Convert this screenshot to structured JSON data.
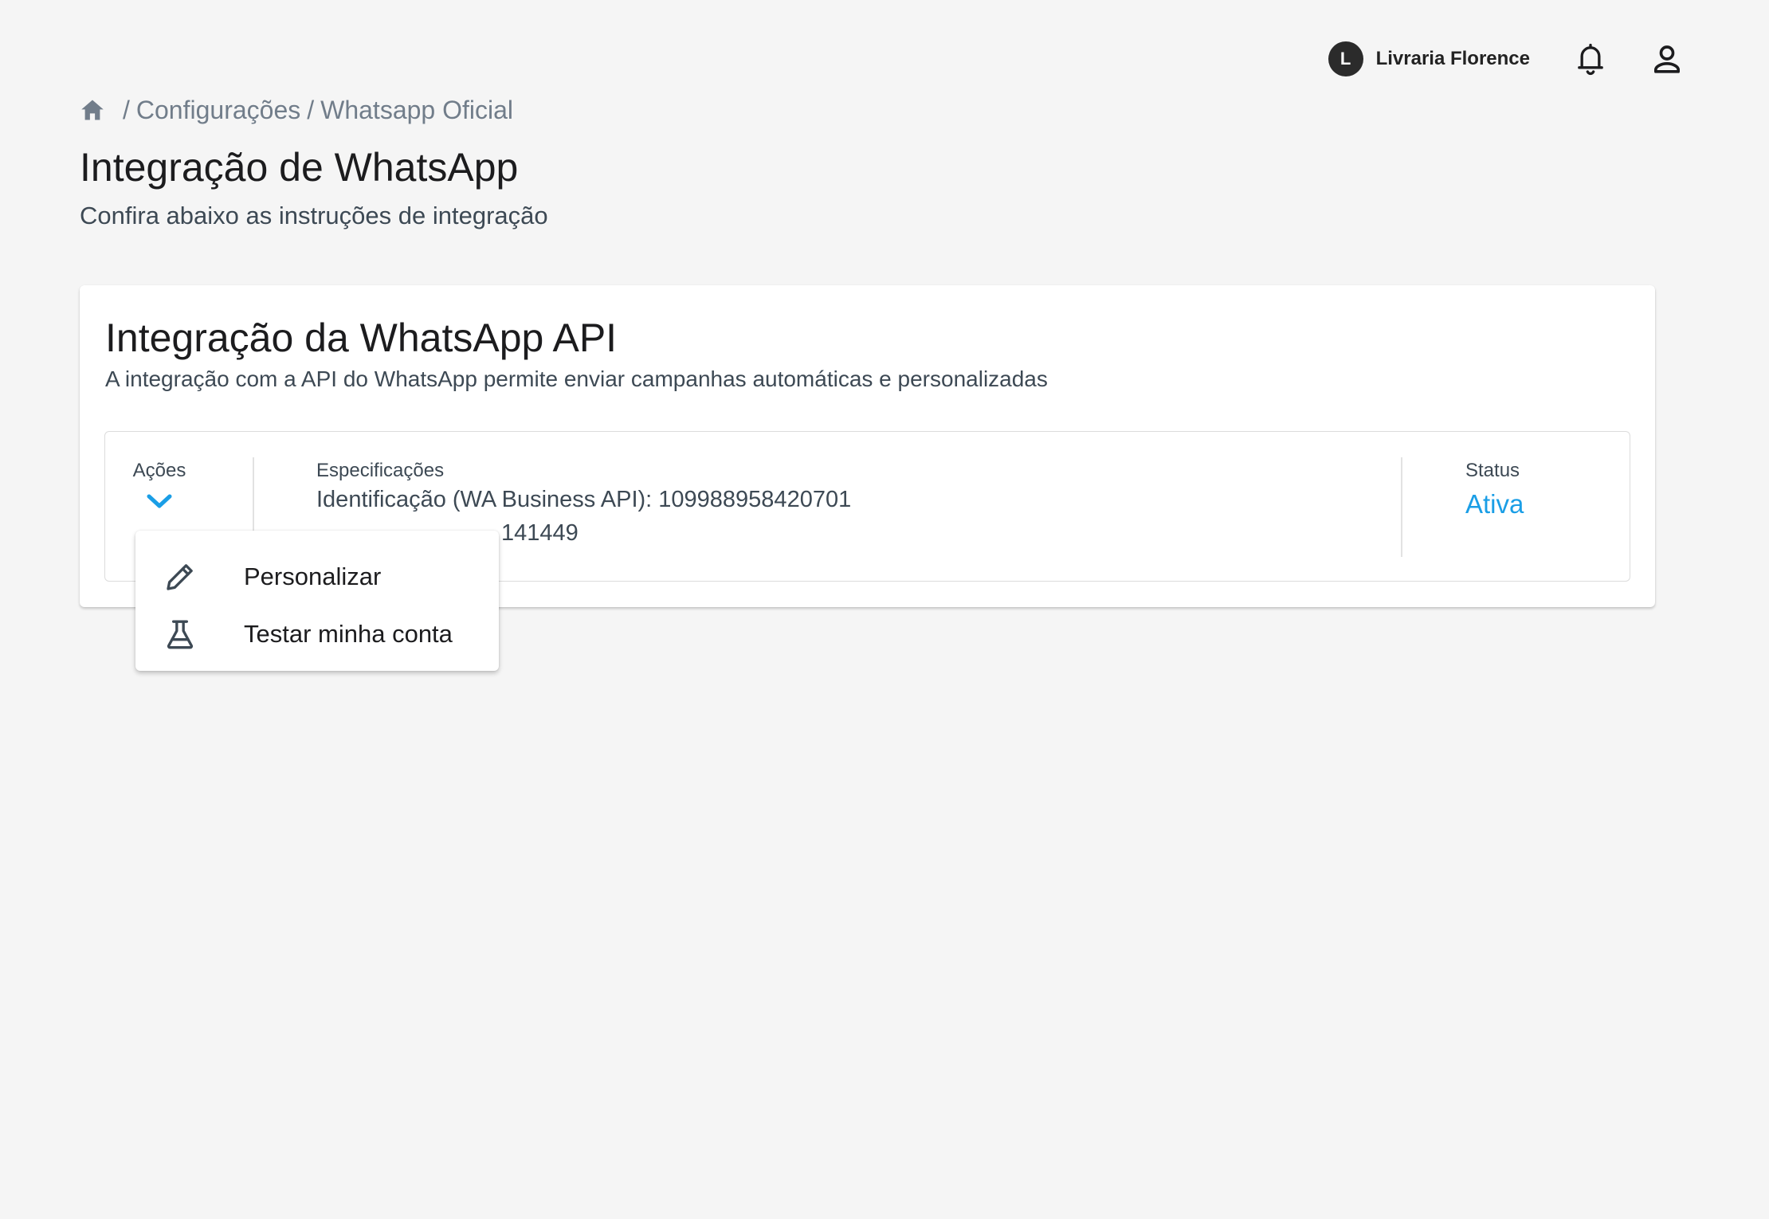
{
  "topbar": {
    "account_initial": "L",
    "account_name": "Livraria Florence"
  },
  "icons": {
    "home": "home-icon",
    "bell": "bell-icon",
    "user": "user-icon",
    "chevron": "chevron-down-icon",
    "pencil": "pencil-icon",
    "flask": "flask-icon"
  },
  "breadcrumb": {
    "separator": "/",
    "items": [
      "Configurações",
      "Whatsapp Oficial"
    ]
  },
  "header": {
    "title": "Integração de WhatsApp",
    "subtitle": "Confira abaixo as instruções de integração"
  },
  "card": {
    "title": "Integração da WhatsApp API",
    "description": "A integração com a API do WhatsApp permite enviar campanhas automáticas e personalizadas",
    "actions_label": "Ações",
    "specs_label": "Especificações",
    "specs": [
      "Identificação (WA Business API): 109988958420701",
      "141449"
    ],
    "status_label": "Status",
    "status_value": "Ativa"
  },
  "menu": {
    "items": [
      {
        "label": "Personalizar"
      },
      {
        "label": "Testar minha conta"
      }
    ]
  },
  "colors": {
    "background": "#f5f5f5",
    "accent": "#1a9ee6",
    "text_primary": "#1c1c1e",
    "text_secondary": "#3d4954",
    "breadcrumb": "#717d8a"
  }
}
